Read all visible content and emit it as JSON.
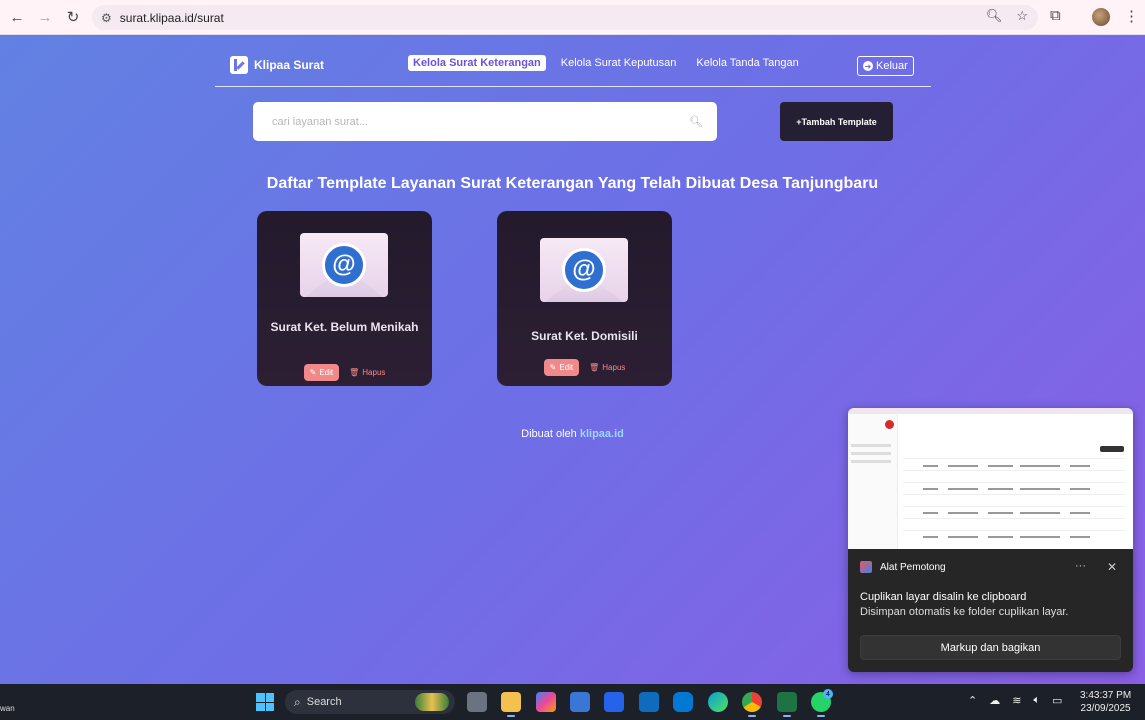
{
  "browser": {
    "url": "surat.klipaa.id/surat"
  },
  "nav": {
    "brand": "Klipaa Surat",
    "menu": [
      "Kelola Surat Keterangan",
      "Kelola Surat Keputusan",
      "Kelola Tanda Tangan"
    ],
    "logout": "Keluar"
  },
  "search": {
    "placeholder": "cari layanan surat..."
  },
  "add_button": "+Tambah Template",
  "heading": "Daftar Template Layanan Surat Keterangan Yang Telah Dibuat Desa Tanjungbaru",
  "cards": [
    {
      "title": "Surat Ket. Belum Menikah",
      "edit": "Edit",
      "delete": "Hapus"
    },
    {
      "title": "Surat Ket. Domisili",
      "edit": "Edit",
      "delete": "Hapus"
    }
  ],
  "footer": {
    "text": "Dibuat oleh",
    "link": "klipaa.id"
  },
  "notification": {
    "app": "Alat Pemotong",
    "title": "Cuplikan layar disalin ke clipboard",
    "body": "Disimpan otomatis ke folder cuplikan layar.",
    "button": "Markup dan bagikan"
  },
  "taskbar": {
    "left_text": "wan",
    "search": "Search",
    "time": "3:43:37 PM",
    "date": "23/09/2025",
    "whatsapp_badge": "4"
  },
  "colors": {
    "accent": "#6b52d8",
    "card_bg": "#231a2c",
    "edit_bg": "#f08a8a",
    "link": "#9ed5ff"
  }
}
